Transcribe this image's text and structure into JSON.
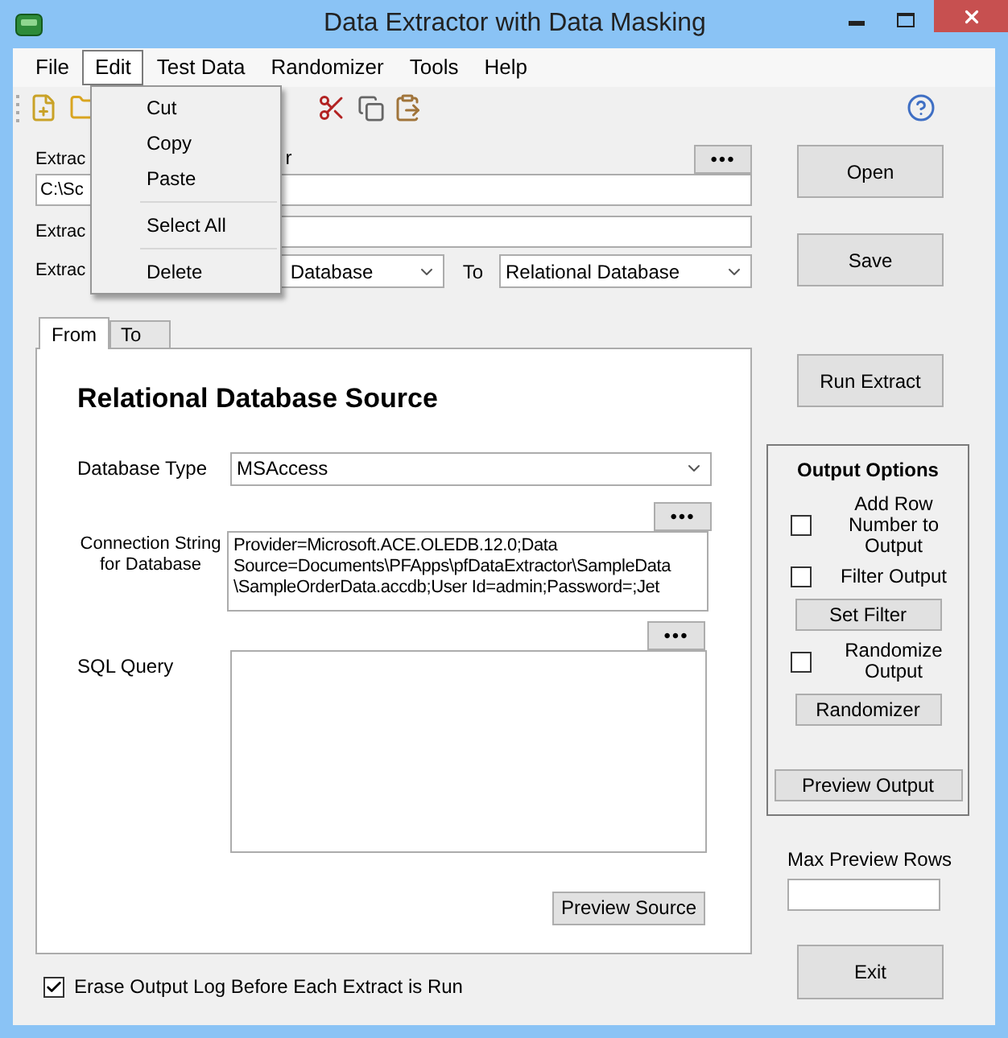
{
  "window": {
    "title": "Data Extractor with Data Masking"
  },
  "menu_bar": [
    {
      "label": "File",
      "selected": false
    },
    {
      "label": "Edit",
      "selected": true
    },
    {
      "label": "Test Data",
      "selected": false
    },
    {
      "label": "Randomizer",
      "selected": false
    },
    {
      "label": "Tools",
      "selected": false
    },
    {
      "label": "Help",
      "selected": false
    }
  ],
  "edit_menu": [
    {
      "kind": "item",
      "label": "Cut"
    },
    {
      "kind": "item",
      "label": "Copy"
    },
    {
      "kind": "item",
      "label": "Paste"
    },
    {
      "kind": "separator"
    },
    {
      "kind": "item",
      "label": "Select All"
    },
    {
      "kind": "separator"
    },
    {
      "kind": "item",
      "label": "Delete"
    }
  ],
  "extract_file": {
    "label": "Extrac",
    "label_tail": "r",
    "browse_button": "•••",
    "value": "C:\\Sc"
  },
  "extract_name": {
    "label": "Extrac"
  },
  "extract_type": {
    "label": "Extrac",
    "from_value": "Database",
    "to_label": "To",
    "to_value": "Relational Database"
  },
  "tabs": [
    {
      "label": "From",
      "selected": true
    },
    {
      "label": "To",
      "selected": false
    }
  ],
  "source_panel": {
    "heading": "Relational Database Source",
    "database_type": {
      "label": "Database Type",
      "value": "MSAccess"
    },
    "connection_string": {
      "label_lines": [
        "Connection String",
        "for Database"
      ],
      "browse_button": "•••",
      "value_lines": [
        "Provider=Microsoft.ACE.OLEDB.12.0;Data",
        "Source=Documents\\PFApps\\pfDataExtractor\\SampleData",
        "\\SampleOrderData.accdb;User Id=admin;Password=;Jet"
      ]
    },
    "sql_query": {
      "label": "SQL Query",
      "browse_button": "•••"
    },
    "preview_button": "Preview Source"
  },
  "erase_log": {
    "label": "Erase Output Log Before Each Extract is Run",
    "checked": true
  },
  "buttons": {
    "open": "Open",
    "save": "Save",
    "run": "Run Extract",
    "exit": "Exit"
  },
  "output_options": {
    "title": "Output Options",
    "items": [
      {
        "kind": "checkbox",
        "label": "Add Row Number to Output",
        "checked": false
      },
      {
        "kind": "checkbox",
        "label": "Filter Output",
        "checked": false
      },
      {
        "kind": "button",
        "label": "Set Filter"
      },
      {
        "kind": "checkbox",
        "label": "Randomize Output",
        "checked": false
      },
      {
        "kind": "button",
        "label": "Randomizer"
      }
    ],
    "preview_button": "Preview Output"
  },
  "max_preview_rows": {
    "label": "Max Preview Rows"
  }
}
